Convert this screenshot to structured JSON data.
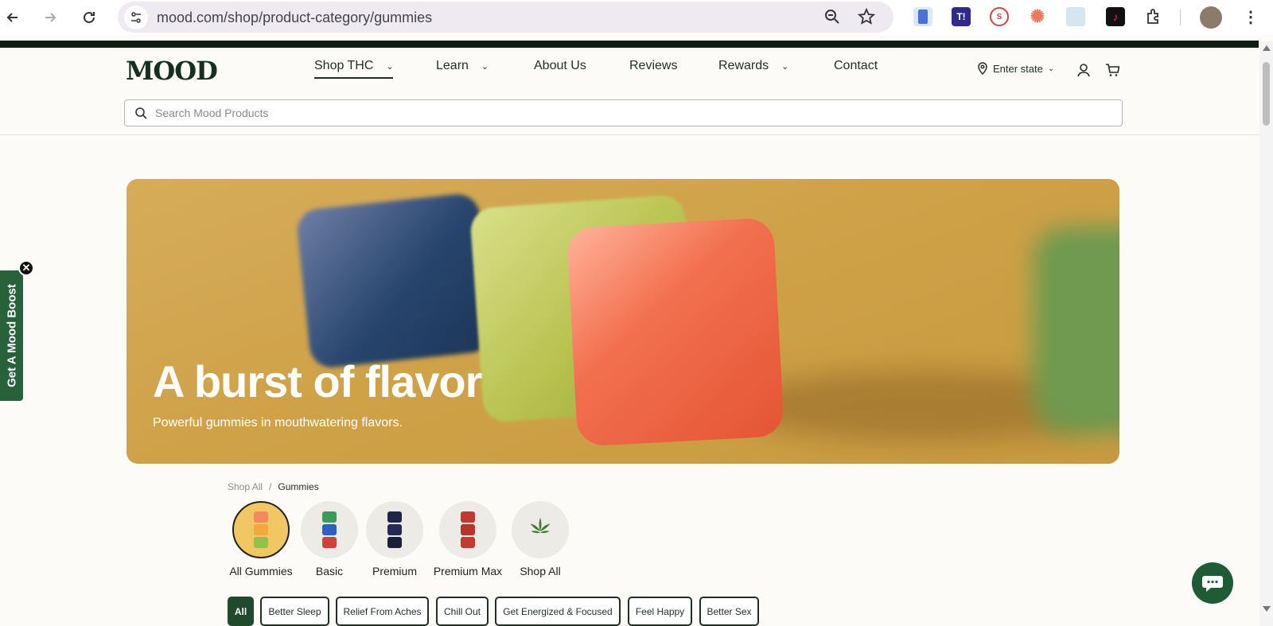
{
  "browser": {
    "url": "mood.com/shop/product-category/gummies",
    "extensions": [
      {
        "name": "phone-extension-icon",
        "color": "#4a72d6"
      },
      {
        "name": "t-extension-icon",
        "label": "T!",
        "color": "#2d2a8c"
      },
      {
        "name": "s-extension-icon",
        "color": "#c44"
      },
      {
        "name": "burst-extension-icon",
        "color": "#e8795a"
      },
      {
        "name": "cloud-extension-icon",
        "color": "#d5e6f3"
      },
      {
        "name": "tiktok-extension-icon",
        "color": "#111"
      }
    ]
  },
  "site": {
    "logo": "MOOD",
    "nav": [
      {
        "label": "Shop THC",
        "has_menu": true
      },
      {
        "label": "Learn",
        "has_menu": true
      },
      {
        "label": "About Us",
        "has_menu": false
      },
      {
        "label": "Reviews",
        "has_menu": false
      },
      {
        "label": "Rewards",
        "has_menu": true
      },
      {
        "label": "Contact",
        "has_menu": false
      }
    ],
    "state_select": "Enter state",
    "search_placeholder": "Search Mood Products"
  },
  "hero": {
    "title": "A burst of flavor",
    "subtitle": "Powerful gummies in mouthwatering flavors."
  },
  "side_tab": {
    "label": "Get A Mood Boost"
  },
  "breadcrumb": {
    "root": "Shop All",
    "separator": "/",
    "current": "Gummies"
  },
  "categories": [
    {
      "label": "All Gummies",
      "active": true
    },
    {
      "label": "Basic",
      "active": false
    },
    {
      "label": "Premium",
      "active": false
    },
    {
      "label": "Premium Max",
      "active": false
    },
    {
      "label": "Shop All",
      "active": false
    }
  ],
  "filters": [
    {
      "label": "All",
      "active": true
    },
    {
      "label": "Better Sleep",
      "active": false
    },
    {
      "label": "Relief From Aches",
      "active": false
    },
    {
      "label": "Chill Out",
      "active": false
    },
    {
      "label": "Get Energized & Focused",
      "active": false
    },
    {
      "label": "Feel Happy",
      "active": false
    },
    {
      "label": "Better Sex",
      "active": false
    }
  ],
  "colors": {
    "brand_green": "#1f4a2c",
    "hero_bg": "#cfa248",
    "active_category": "#f0c762"
  }
}
